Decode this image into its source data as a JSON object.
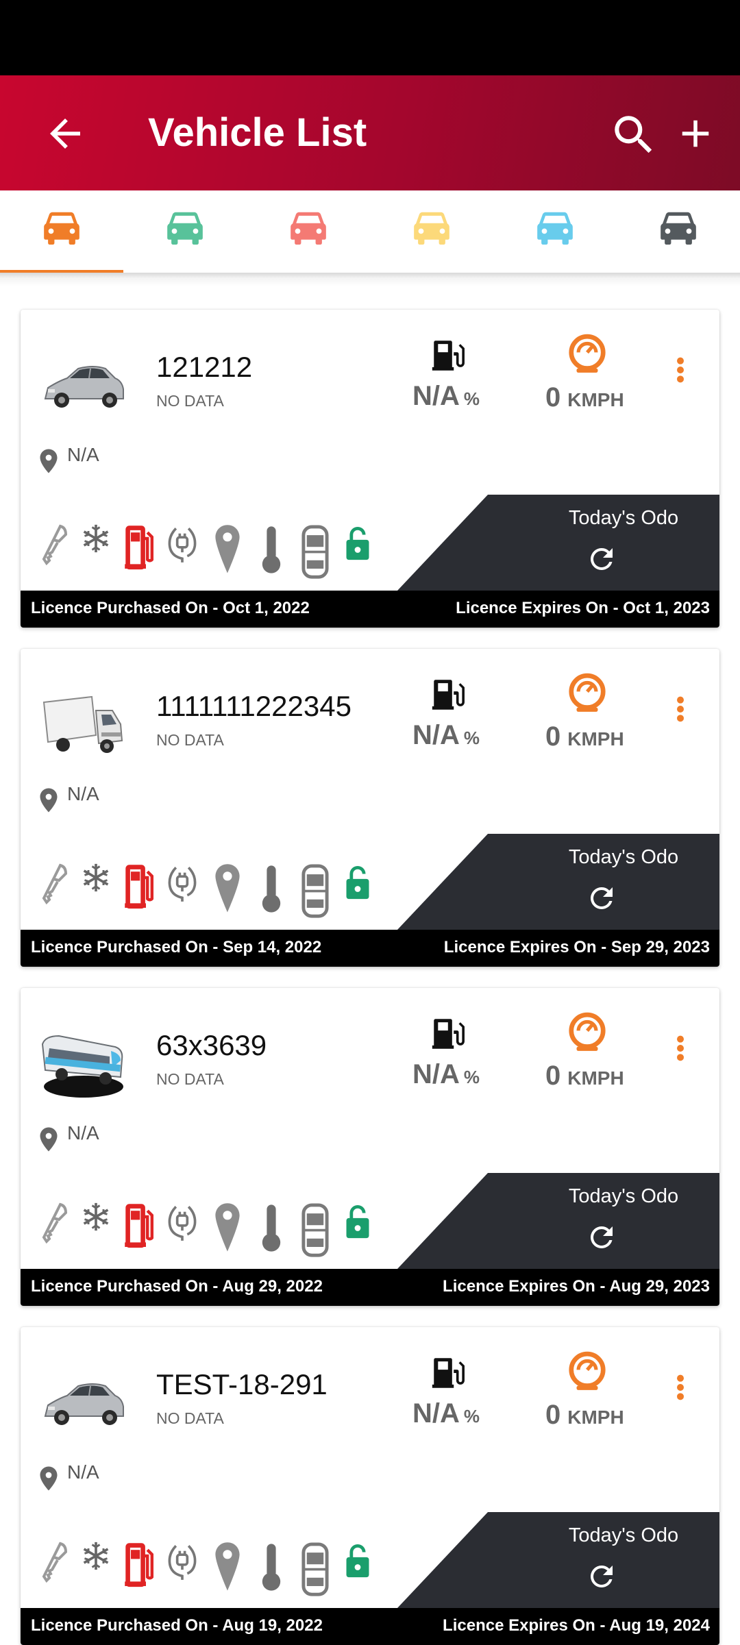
{
  "app_bar": {
    "title": "Vehicle List"
  },
  "tabs": [
    {
      "name": "all",
      "color": "#f07d28",
      "selected": true
    },
    {
      "name": "running",
      "color": "#58c29a"
    },
    {
      "name": "stopped",
      "color": "#f47a74"
    },
    {
      "name": "idle",
      "color": "#fcd97a"
    },
    {
      "name": "inactive",
      "color": "#68ccec"
    },
    {
      "name": "no-data",
      "color": "#545a5e"
    }
  ],
  "vehicles": [
    {
      "image": "car-silver",
      "name": "121212",
      "status": "NO DATA",
      "fuel": {
        "value": "N/A",
        "unit": "%"
      },
      "speed": {
        "value": "0",
        "unit": "KMPH"
      },
      "location": "N/A",
      "odo_label": "Today's Odo",
      "licence_purchased": "Licence Purchased On - Oct 1, 2022",
      "licence_expires": "Licence Expires On - Oct 1, 2023"
    },
    {
      "image": "truck-white",
      "name": "1111111222345",
      "status": "NO DATA",
      "fuel": {
        "value": "N/A",
        "unit": "%"
      },
      "speed": {
        "value": "0",
        "unit": "KMPH"
      },
      "location": "N/A",
      "odo_label": "Today's Odo",
      "licence_purchased": "Licence Purchased On - Sep 14, 2022",
      "licence_expires": "Licence Expires On - Sep 29, 2023"
    },
    {
      "image": "bus-blue",
      "name": "63x3639",
      "status": "NO DATA",
      "fuel": {
        "value": "N/A",
        "unit": "%"
      },
      "speed": {
        "value": "0",
        "unit": "KMPH"
      },
      "location": "N/A",
      "odo_label": "Today's Odo",
      "licence_purchased": "Licence Purchased On - Aug 29, 2022",
      "licence_expires": "Licence Expires On - Aug 29, 2023"
    },
    {
      "image": "car-silver",
      "name": "TEST-18-291",
      "status": "NO DATA",
      "fuel": {
        "value": "N/A",
        "unit": "%"
      },
      "speed": {
        "value": "0",
        "unit": "KMPH"
      },
      "location": "N/A",
      "odo_label": "Today's Odo",
      "licence_purchased": "Licence Purchased On - Aug 19, 2022",
      "licence_expires": "Licence Expires On - Aug 19, 2024"
    }
  ],
  "feature_icons": [
    "ignition-key-icon",
    "ac-snowflake-icon",
    "fuel-pump-icon",
    "power-plug-icon",
    "location-pin-icon",
    "temperature-icon",
    "door-icon",
    "lock-icon"
  ],
  "colors": {
    "accent": "#f07d28",
    "header": "#b2062e",
    "lock": "#1a9e6c",
    "fuel_red": "#e02424",
    "odo_panel": "#2b2d33"
  }
}
